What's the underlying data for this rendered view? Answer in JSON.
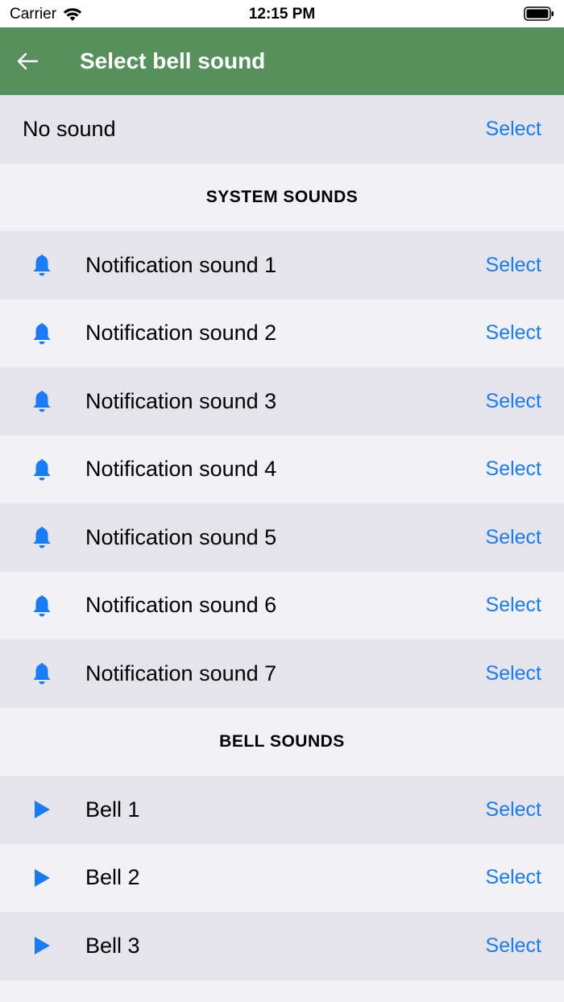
{
  "status_bar": {
    "carrier": "Carrier",
    "time": "12:15 PM"
  },
  "app_bar": {
    "title": "Select bell sound",
    "color": "#58905d"
  },
  "accent_color": "#1a7cf4",
  "no_sound": {
    "label": "No sound",
    "action": "Select"
  },
  "system_sounds": {
    "header": "SYSTEM SOUNDS",
    "icon": "bell-icon",
    "items": [
      {
        "label": "Notification sound 1",
        "action": "Select"
      },
      {
        "label": "Notification sound 2",
        "action": "Select"
      },
      {
        "label": "Notification sound 3",
        "action": "Select"
      },
      {
        "label": "Notification sound 4",
        "action": "Select"
      },
      {
        "label": "Notification sound 5",
        "action": "Select"
      },
      {
        "label": "Notification sound 6",
        "action": "Select"
      },
      {
        "label": "Notification sound 7",
        "action": "Select"
      }
    ]
  },
  "bell_sounds": {
    "header": "BELL SOUNDS",
    "icon": "play-icon",
    "items": [
      {
        "label": "Bell 1",
        "action": "Select"
      },
      {
        "label": "Bell 2",
        "action": "Select"
      },
      {
        "label": "Bell 3",
        "action": "Select"
      }
    ]
  }
}
